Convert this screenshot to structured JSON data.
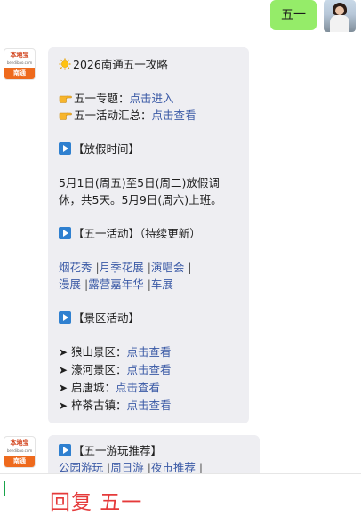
{
  "user_message": "五一",
  "bot_logo": {
    "top": "本地宝",
    "url": "bendibao.com",
    "city": "南通"
  },
  "message1": {
    "title": "2026南通五一攻略",
    "topic_label": "五一专题：",
    "topic_link": "点击进入",
    "summary_label": "五一活动汇总：",
    "summary_link": "点击查看",
    "holiday_heading": "【放假时间】",
    "holiday_text": "5月1日(周五)至5日(周二)放假调休，共5天。5月9日(周六)上班。",
    "activities_heading": "【五一活动】（持续更新）",
    "activity_links_row1": [
      "烟花秀",
      "月季花展",
      "演唱会"
    ],
    "activity_links_row2": [
      "漫展",
      "露营嘉年华",
      "车展"
    ],
    "scenic_heading": "【景区活动】",
    "scenic_items": [
      {
        "name": "狼山景区：",
        "link": "点击查看"
      },
      {
        "name": "濠河景区：",
        "link": "点击查看"
      },
      {
        "name": "启唐城：",
        "link": "点击查看"
      },
      {
        "name": "梓茶古镇：",
        "link": "点击查看"
      }
    ]
  },
  "message2": {
    "heading": "【五一游玩推荐】",
    "links": [
      "公园游玩",
      "周日游",
      "夜市推荐"
    ]
  },
  "input": {
    "text": "回复 五一"
  },
  "colors": {
    "user_bubble": "#95ec69",
    "bot_bubble": "#eeeef2",
    "link": "#3b5aa6",
    "input_text": "#e53a3a",
    "cursor": "#19a34a"
  }
}
